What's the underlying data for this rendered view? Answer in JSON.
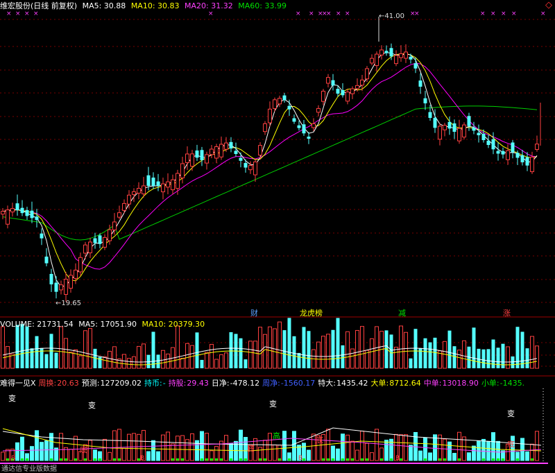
{
  "colors": {
    "up": "#ff4040",
    "down": "#54ffff",
    "ma5": "#ffffff",
    "ma10": "#ffff00",
    "ma20": "#ff00ff",
    "ma60": "#00d000",
    "grid": "#7a0000"
  },
  "header": {
    "title": "维宏股份(日线 前复权)",
    "ma5": "MA5: 30.88",
    "ma10": "MA10: 30.83",
    "ma20": "MA20: 31.32",
    "ma60": "MA60: 33.99"
  },
  "price_panel": {
    "high_label": "41.00",
    "low_label": "19.65",
    "events": [
      "财",
      "龙虎榜",
      "减",
      "涨"
    ]
  },
  "volume_panel": {
    "title": "VOLUME: 21731.54",
    "ma5": "MA5: 17051.90",
    "ma10": "MA10: 20379.30"
  },
  "indicator_panel": {
    "name": "难得一见X",
    "zhouhuan_label": "周换:",
    "zhouhuan_value": "20.63",
    "yuce_label": "预测:",
    "yuce_value": "127209.02",
    "chibi_label": "持币:",
    "chibi_value": "-",
    "chigu_label": "持股:",
    "chigu_value": "29.43",
    "rijing_label": "日净:",
    "rijing_value": "-478.12",
    "zhoujing_label": "周净:",
    "zhoujing_value": "-1560.17",
    "teda_label": "特大:",
    "teda_value": "1435.42",
    "dadan_label": "大单:",
    "dadan_value": "8712.64",
    "zhongdan_label": "中单:",
    "zhongdan_value": "13018.90",
    "xiaodan_label": "小单:",
    "xiaodan_value": "-1435.",
    "change_marks": [
      "变",
      "变",
      "变",
      "变"
    ],
    "signals": [
      "高",
      "底",
      "底",
      "底",
      "底",
      "B",
      "B",
      "B",
      "B"
    ],
    "footer": "通达信专业版数据"
  },
  "corner_icon": "diamond-icon",
  "chart_data": {
    "type": "candlestick",
    "title": "维宏股份(日线 前复权)",
    "ylim": [
      19.65,
      41.0
    ],
    "annotations": [
      {
        "label": "41.00",
        "value": 41.0,
        "kind": "high"
      },
      {
        "label": "19.65",
        "value": 19.65,
        "kind": "low"
      }
    ],
    "series": [
      {
        "name": "MA5",
        "last": 30.88
      },
      {
        "name": "MA10",
        "last": 30.83
      },
      {
        "name": "MA20",
        "last": 31.32
      },
      {
        "name": "MA60",
        "last": 33.99
      }
    ],
    "volume": {
      "last": 21731.54,
      "ma5": 17051.9,
      "ma10": 20379.3
    }
  }
}
